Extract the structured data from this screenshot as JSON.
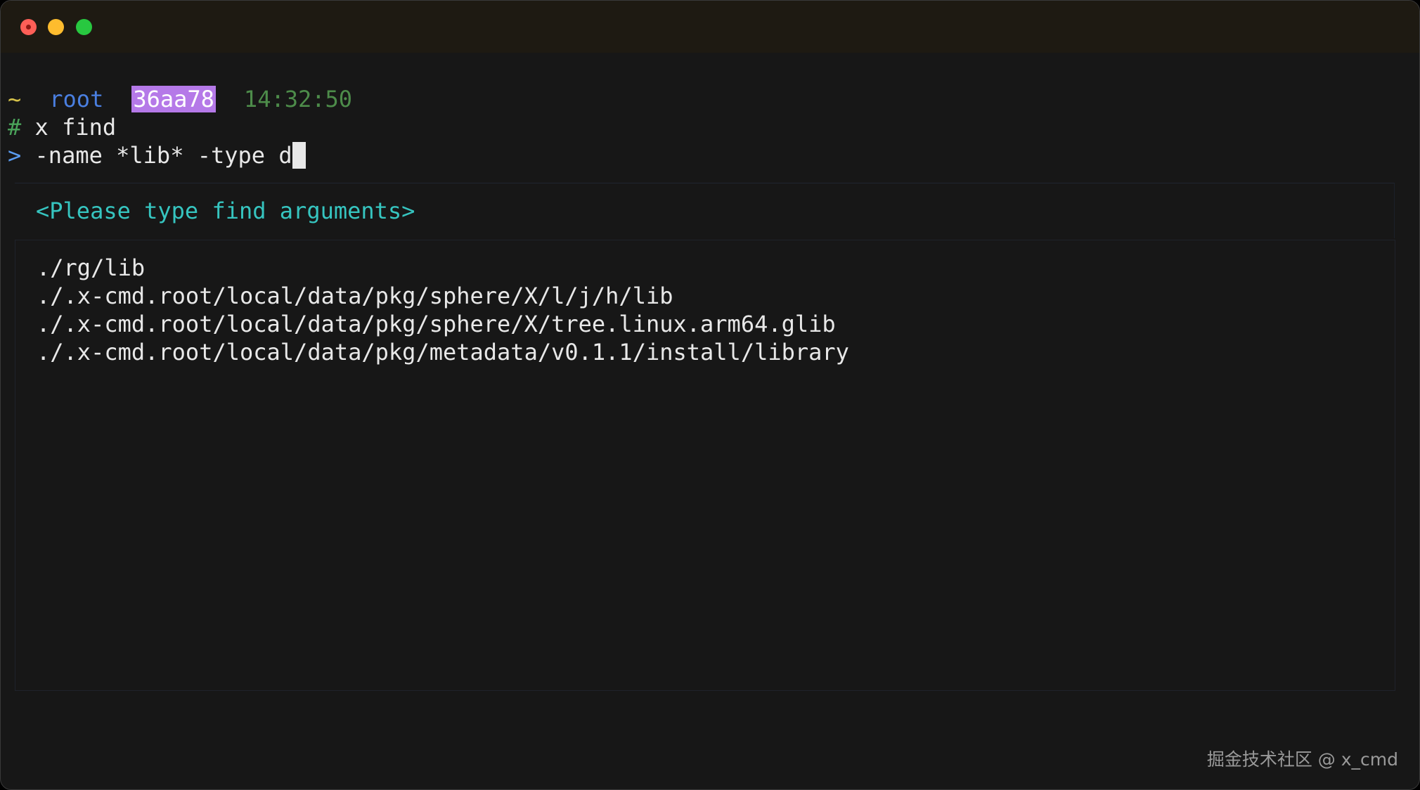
{
  "window": {
    "controls": [
      "close-button",
      "minimize-button",
      "zoom-button"
    ]
  },
  "prompt": {
    "tilde": "~",
    "user": "root",
    "host": "36aa78",
    "time": "14:32:50"
  },
  "command": {
    "symbol": "#",
    "text": "x find"
  },
  "input": {
    "symbol": ">",
    "value": "-name *lib* -type d"
  },
  "hint": {
    "text": "<Please type find arguments>"
  },
  "results": [
    "./rg/lib",
    "./.x-cmd.root/local/data/pkg/sphere/X/l/j/h/lib",
    "./.x-cmd.root/local/data/pkg/sphere/X/tree.linux.arm64.glib",
    "./.x-cmd.root/local/data/pkg/metadata/v0.1.1/install/library"
  ],
  "watermark": {
    "text": "掘金技术社区 @ x_cmd"
  },
  "colors": {
    "background": "#171717",
    "titlebar": "#1e1a12",
    "host_badge": "#b579e8",
    "hint": "#36c5c0",
    "user": "#4a7fe0",
    "time": "#4d8c4a"
  }
}
